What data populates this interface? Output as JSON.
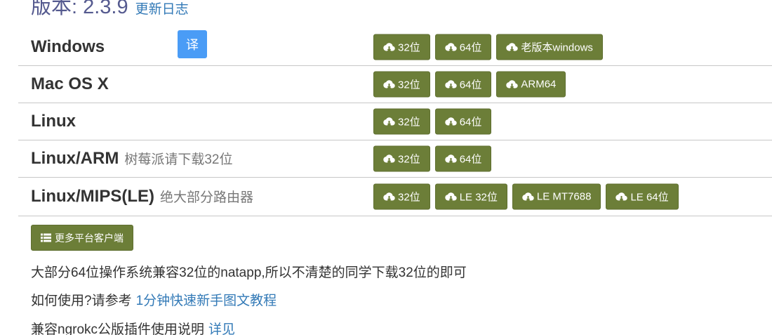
{
  "header": {
    "version_text": "版本: 2.3.9",
    "changelog_link": "更新日志"
  },
  "translate_label": "译",
  "platforms": [
    {
      "name": "Windows",
      "note": "",
      "buttons": [
        "32位",
        "64位",
        "老版本windows"
      ]
    },
    {
      "name": "Mac OS X",
      "note": "",
      "buttons": [
        "32位",
        "64位",
        "ARM64"
      ]
    },
    {
      "name": "Linux",
      "note": "",
      "buttons": [
        "32位",
        "64位"
      ]
    },
    {
      "name": "Linux/ARM",
      "note": "树莓派请下载32位",
      "buttons": [
        "32位",
        "64位"
      ]
    },
    {
      "name": "Linux/MIPS(LE)",
      "note": "绝大部分路由器",
      "buttons": [
        "32位",
        "LE 32位",
        "LE MT7688",
        "LE 64位"
      ]
    }
  ],
  "more_clients_label": "更多平台客户端",
  "info": {
    "compat_note": "大部分64位操作系统兼容32位的natapp,所以不清楚的同学下载32位的即可",
    "howto_prefix": "如何使用?请参考",
    "howto_link": "1分钟快速新手图文教程",
    "ngrok_prefix": "兼容ngrokc公版插件使用说明",
    "ngrok_link": "详见"
  },
  "colors": {
    "button_bg": "#6c7e38",
    "translate_bg": "#4a9cf6",
    "link": "#337ab7",
    "version": "#555a8f"
  },
  "icons": {
    "download": "cloud-download-icon",
    "list": "list-icon"
  }
}
